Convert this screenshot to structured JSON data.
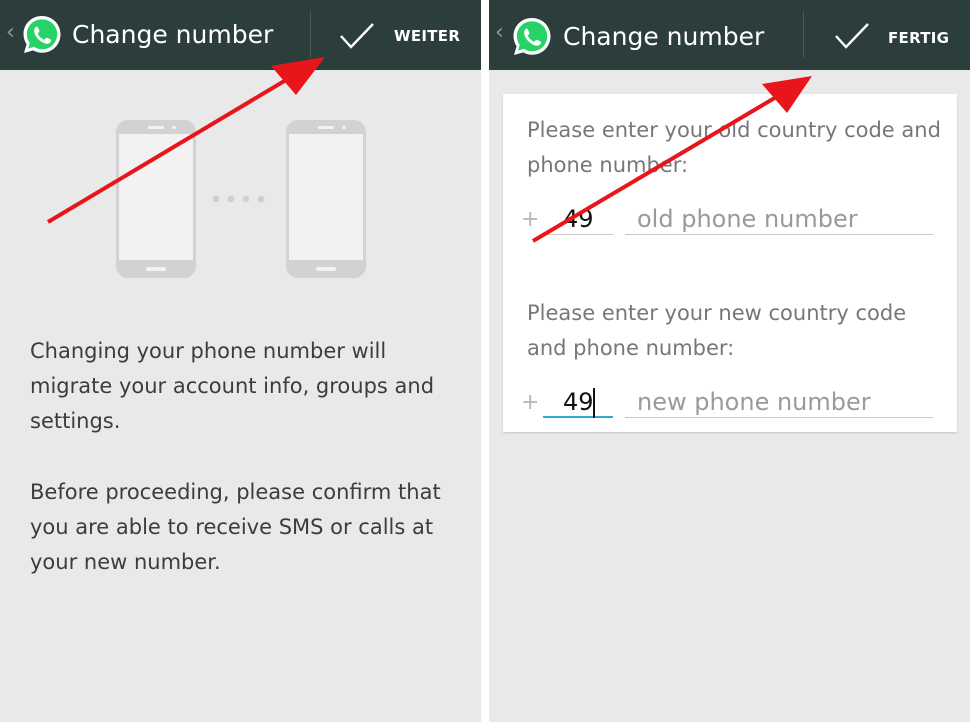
{
  "left_screen": {
    "header": {
      "title": "Change number",
      "action_label": "WEITER"
    },
    "description": [
      "Changing your phone number will migrate your account info, groups and settings.",
      "Before proceeding, please confirm that you are able to receive SMS or calls at your new number."
    ]
  },
  "right_screen": {
    "header": {
      "title": "Change number",
      "action_label": "FERTIG"
    },
    "old_number": {
      "prompt": "Please enter your old country code and phone number:",
      "plus": "+",
      "country_code": "49",
      "placeholder": "old phone number"
    },
    "new_number": {
      "prompt": "Please enter your new country code and phone number:",
      "plus": "+",
      "country_code": "49",
      "placeholder": "new phone number"
    }
  },
  "colors": {
    "actionbar": "#2c3e3b",
    "whatsapp_green": "#25d366",
    "annotation_arrow": "#e8161b",
    "focus_underline": "#33a8d8"
  }
}
